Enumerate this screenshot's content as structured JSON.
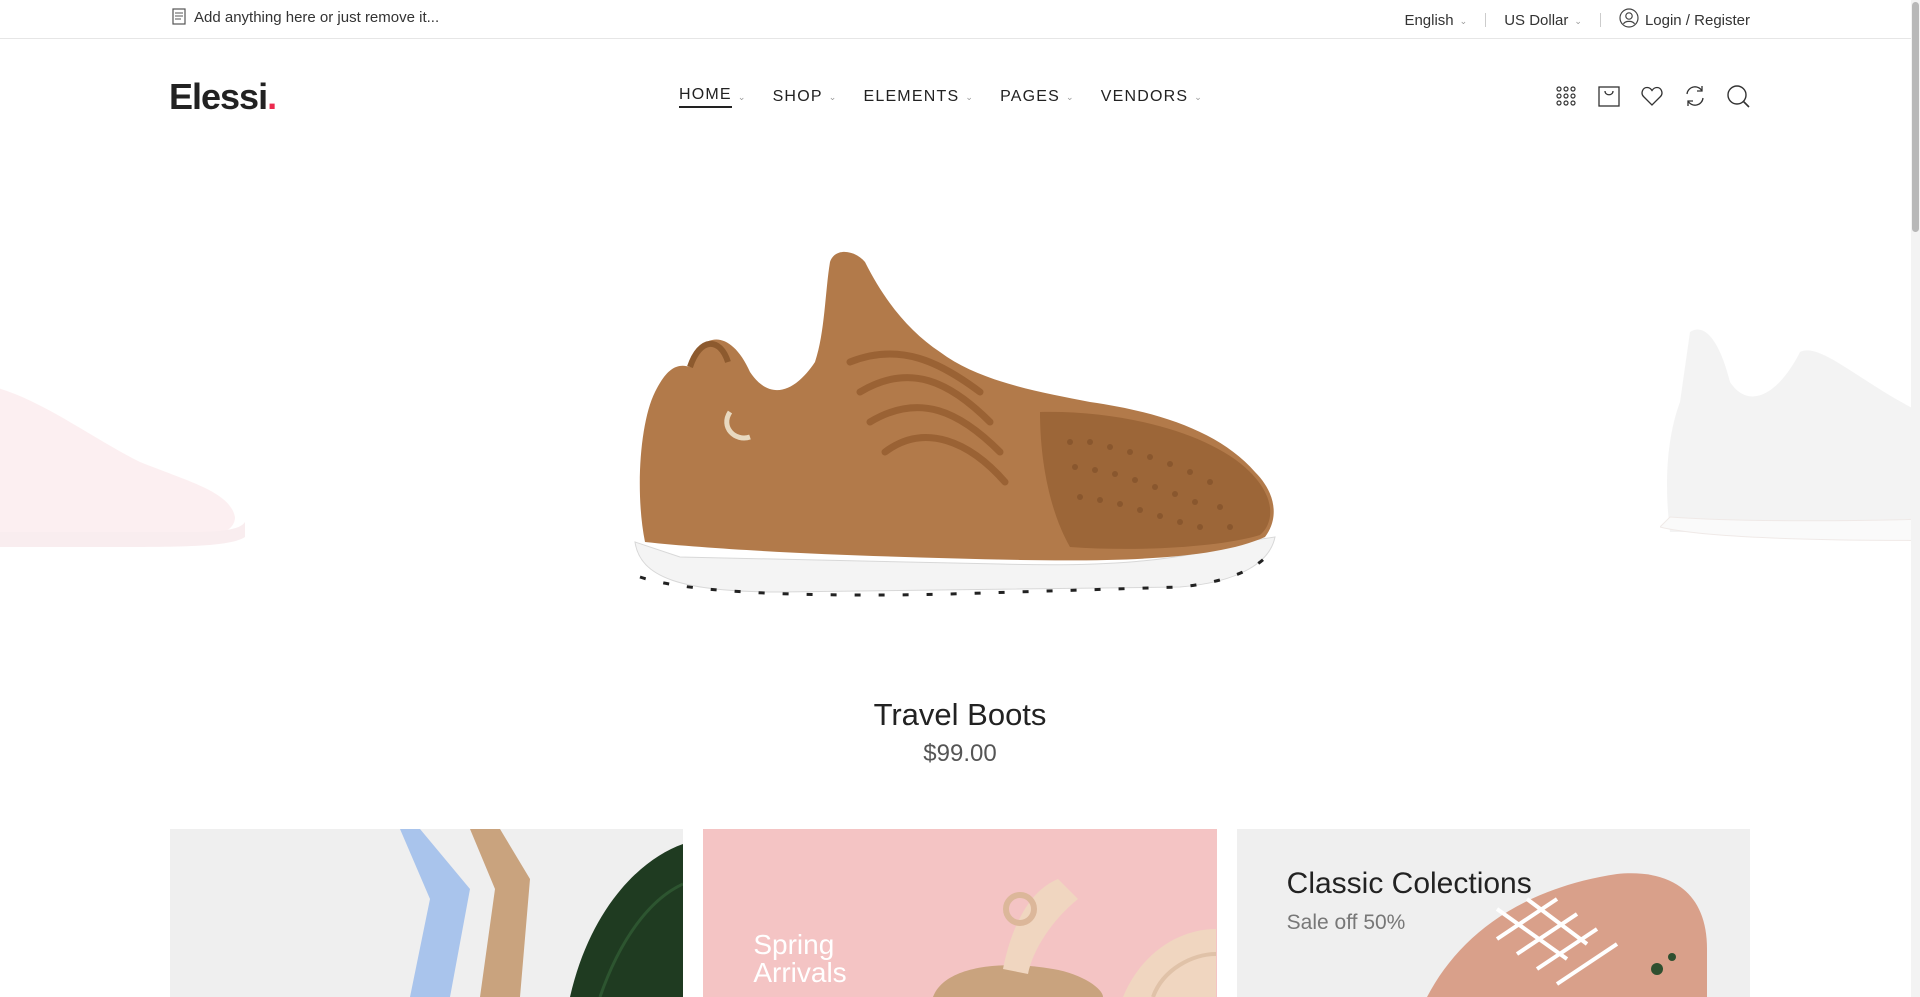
{
  "topbar": {
    "message": "Add anything here or just remove it...",
    "language": "English",
    "currency": "US Dollar",
    "login": "Login / Register"
  },
  "header": {
    "logo": "Elessi",
    "logo_dot": ".",
    "nav": [
      {
        "label": "HOME",
        "active": true
      },
      {
        "label": "SHOP"
      },
      {
        "label": "ELEMENTS"
      },
      {
        "label": "PAGES"
      },
      {
        "label": "VENDORS"
      }
    ],
    "icons": [
      "grid-icon",
      "cart-icon",
      "heart-icon",
      "compare-icon",
      "search-icon"
    ]
  },
  "slider": {
    "product_title": "Travel Boots",
    "product_price": "$99.00"
  },
  "banners": [
    {
      "title": ""
    },
    {
      "title_line1": "Spring",
      "title_line2": "Arrivals"
    },
    {
      "title": "Classic Colections",
      "subtitle": "Sale off 50%"
    }
  ],
  "colors": {
    "accent": "#ec2a4e",
    "banner_pink": "#f4c4c4",
    "banner_grey": "#efefef",
    "shoe_brown": "#b27a4a"
  }
}
